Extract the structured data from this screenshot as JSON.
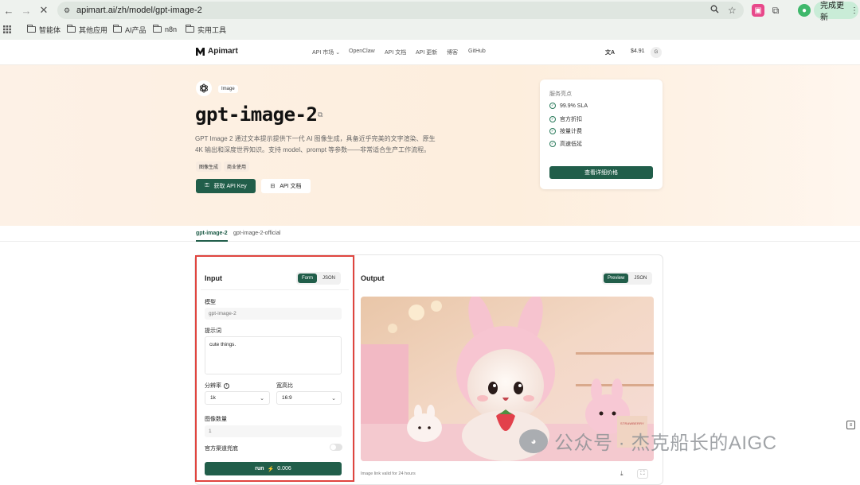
{
  "browser": {
    "url": "apimart.ai/zh/model/gpt-image-2",
    "update_label": "完成更新",
    "profile_initial": "",
    "bookmarks": [
      "智能体",
      "其他应用",
      "AI产品",
      "n8n",
      "实用工具"
    ]
  },
  "site": {
    "brand": "Apimart",
    "nav": [
      "API 市场",
      "OpenClaw",
      "API 文档",
      "API 更新",
      "博客",
      "GitHub"
    ],
    "nav_caret": "⌄",
    "balance": "$4.91",
    "avatar": "G",
    "lang_icon": "文A"
  },
  "hero": {
    "badge": "Image",
    "title": "gpt-image-2",
    "description_line1": "GPT Image 2 通过文本提示提供下一代 AI 图像生成，具备近乎完美的文字渲染、原生",
    "description_line2": "4K 输出和深度世界知识。支持 model、prompt 等参数——非常适合生产工作流程。",
    "tags": [
      "图像生成",
      "商业使用"
    ],
    "api_key_button": "获取 API Key",
    "docs_button": "API 文档"
  },
  "features_card": {
    "heading": "服务亮点",
    "items": [
      "99.9% SLA",
      "官方折扣",
      "按量计费",
      "高速低延"
    ],
    "pricing_button": "查看详细价格"
  },
  "model_tabs": [
    "gpt-image-2",
    "gpt-image-2-official"
  ],
  "input": {
    "title": "Input",
    "form_toggle": "Form",
    "json_toggle": "JSON",
    "model_label": "模型",
    "model_placeholder": "gpt-image-2",
    "prompt_label": "提示词",
    "prompt_value": "cute things.",
    "resolution_label": "分辨率",
    "resolution_value": "1k",
    "aspect_label": "宽高比",
    "aspect_value": "16:9",
    "count_label": "图像数量",
    "count_placeholder": "1",
    "official_label": "官方渠道兜底",
    "run_label": "run",
    "run_cost": "0.006"
  },
  "output": {
    "title": "Output",
    "preview_toggle": "Preview",
    "json_toggle": "JSON",
    "valid_note": "Image link valid for 24 hours",
    "image_sign": "STRAWBERRY"
  },
  "watermark": "公众号 · 杰克船长的AIGC",
  "colors": {
    "accent": "#215e4a",
    "highlight": "#e0453f",
    "hero_bg": "#fdf1e6"
  }
}
